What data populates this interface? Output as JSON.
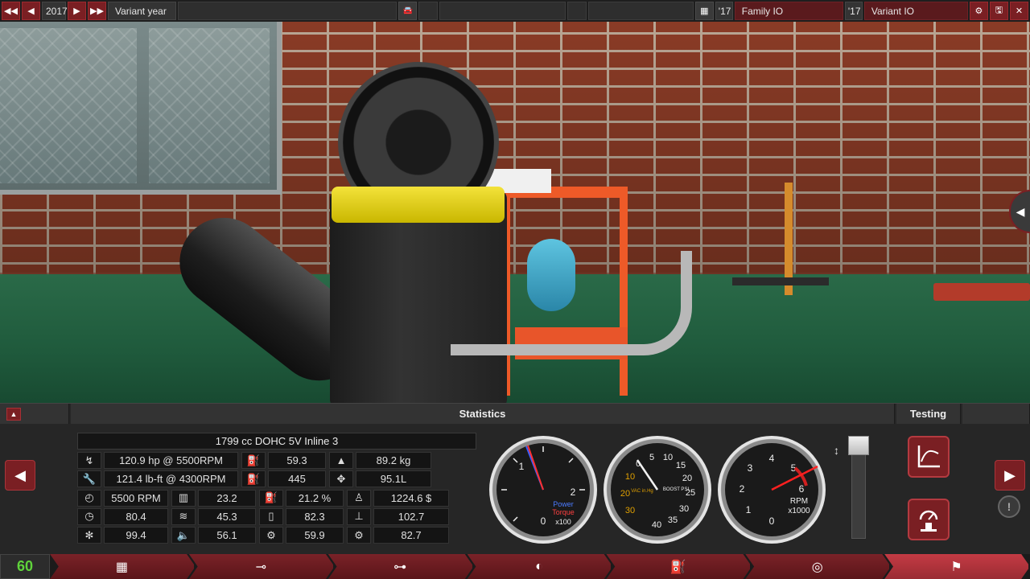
{
  "topbar": {
    "year": "2017",
    "variant_year_label": "Variant year",
    "family_year": "'17",
    "family_name": "Family IO",
    "variant_year_short": "'17",
    "variant_name": "Variant IO"
  },
  "panel": {
    "statistics_title": "Statistics",
    "testing_title": "Testing",
    "engine_name": "1799 cc DOHC 5V Inline 3",
    "rows": [
      {
        "a": "120.9 hp @ 5500RPM",
        "b": "59.3",
        "c": "89.2 kg"
      },
      {
        "a": "121.4 lb-ft @ 4300RPM",
        "b": "445",
        "c": "95.1L"
      },
      {
        "a1": "5500 RPM",
        "a2": "23.2",
        "b": "21.2 %",
        "c": "1224.6 $"
      },
      {
        "a1": "80.4",
        "a2": "45.3",
        "b": "82.3",
        "c": "102.7"
      },
      {
        "a1": "99.4",
        "a2": "56.1",
        "b": "59.9",
        "c": "82.7"
      }
    ],
    "gauges": {
      "power": {
        "ticks": [
          "0",
          "1",
          "2"
        ],
        "label1": "Power",
        "label2": "Torque",
        "unit": "x100"
      },
      "boost": {
        "vac_ticks": [
          "10",
          "20",
          "30"
        ],
        "vac_label": "VAC\nin.Hg",
        "boost_ticks": [
          "0",
          "5",
          "10",
          "15",
          "20",
          "25",
          "30",
          "35",
          "40"
        ],
        "boost_label": "BOOST\nPSI"
      },
      "rpm": {
        "ticks": [
          "0",
          "1",
          "2",
          "3",
          "4",
          "5",
          "6"
        ],
        "label": "RPM",
        "unit": "x1000"
      }
    }
  },
  "tabbar": {
    "fps": "60",
    "active_tab_index": 7
  },
  "colors": {
    "accent_red": "#7a1f23",
    "fps_green": "#5fd33b",
    "boost_yellow": "#e0a000"
  }
}
